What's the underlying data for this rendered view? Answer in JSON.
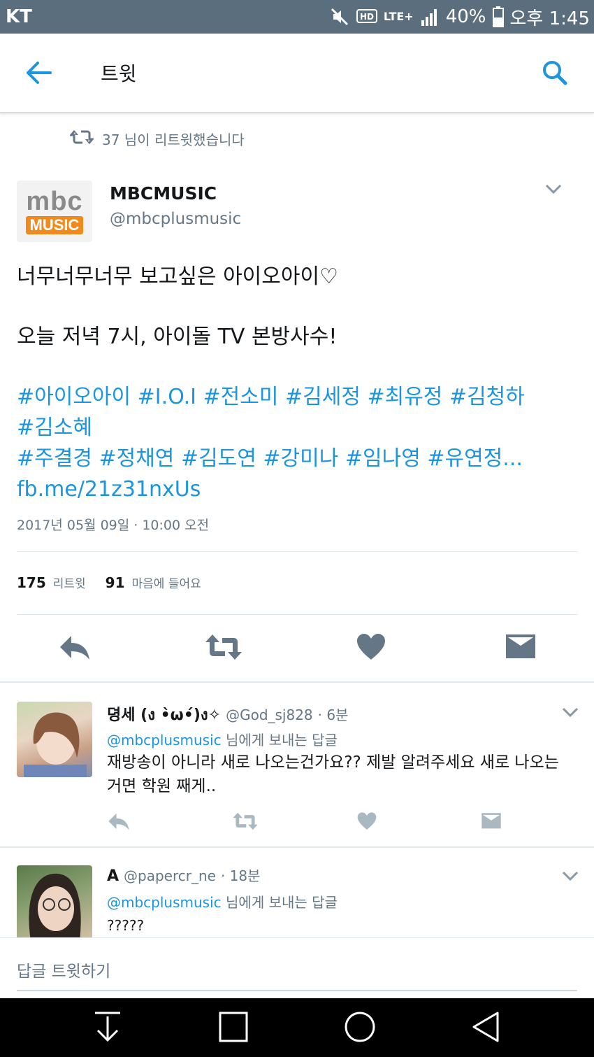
{
  "status_bar": {
    "carrier": "KT",
    "network": "LTE+",
    "battery": "40%",
    "time": "오후 1:45",
    "icons": [
      "mute-icon",
      "hd-icon",
      "lte-icon",
      "signal-icon",
      "battery-icon"
    ]
  },
  "app_bar": {
    "title": "트윗",
    "back_icon": "arrow-left-icon",
    "search_icon": "search-icon"
  },
  "retweet_context": {
    "text": "37 님이 리트윗했습니다"
  },
  "tweet": {
    "author_name": "MBCMUSIC",
    "author_handle": "@mbcplusmusic",
    "avatar_logo": {
      "top": "mbc",
      "bottom": "MUSIC"
    },
    "line1": "너무너무너무 보고싶은 아이오아이♡",
    "line2": "오늘 저녁 7시, 아이돌 TV 본방사수!",
    "hashtags_line1": "#아이오아이 #I.O.I #전소미 #김세정 #최유정 #김청하",
    "hashtags_line2": "#김소혜",
    "hashtags_line3": "#주결경 #정채연 #김도연 #강미나 #임나영 #유연정...",
    "link": "fb.me/21z31nxUs",
    "date": "2017년 05월 09일 · 10:00 오전",
    "retweet_count": "175",
    "retweet_label": "리트윗",
    "like_count": "91",
    "like_label": "마음에 들어요"
  },
  "replies": [
    {
      "name": "뎡세 (ง •̀ω•́)ง✧",
      "handle": "@God_sj828",
      "time": "· 6분",
      "reply_to_handle": "@mbcplusmusic",
      "reply_to_suffix": " 님에게 보내는 답글",
      "text": "재방송이 아니라 새로 나오는건가요?? 제발 알려주세요 새로 나오는거면 학원 째게.."
    },
    {
      "name": "A",
      "handle": "@papercr_ne",
      "time": "· 18분",
      "reply_to_handle": "@mbcplusmusic",
      "reply_to_suffix": " 님에게 보내는 답글",
      "text": "?????"
    }
  ],
  "reply_box": {
    "placeholder": "답글 트윗하기"
  },
  "colors": {
    "status_bar": "#5b6e7e",
    "accent": "#1b95e0",
    "icon_gray": "#657786",
    "text": "#14171a"
  }
}
